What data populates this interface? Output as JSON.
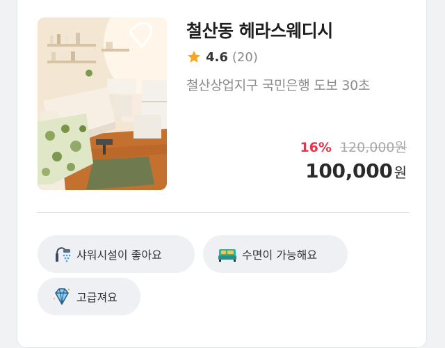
{
  "listing": {
    "title": "철산동 헤라스웨디시",
    "rating": "4.6",
    "review_count": "(20)",
    "location": "철산상업지구 국민은행 도보 30초",
    "discount_rate": "16%",
    "original_price": "120,000원",
    "price": "100,000",
    "currency": "원",
    "image_icon": "massage-room-photo"
  },
  "tags": [
    {
      "label": "샤워시설이 좋아요",
      "icon": "shower-icon"
    },
    {
      "label": "수면이 가능해요",
      "icon": "bed-icon"
    },
    {
      "label": "고급져요",
      "icon": "diamond-icon"
    }
  ],
  "colors": {
    "discount": "#e8334a",
    "star": "#f5a623",
    "tag_background": "#eef0f3"
  }
}
